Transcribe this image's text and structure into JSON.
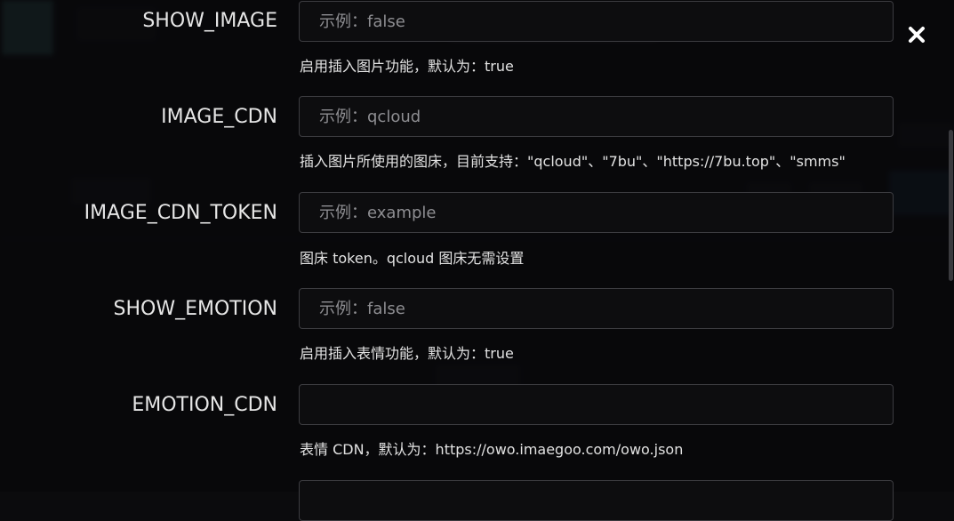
{
  "fields": [
    {
      "label": "SHOW_IMAGE",
      "placeholder": "示例：false",
      "value": "",
      "help": "启用插入图片功能，默认为：true"
    },
    {
      "label": "IMAGE_CDN",
      "placeholder": "示例：qcloud",
      "value": "",
      "help": "插入图片所使用的图床，目前支持：\"qcloud\"、\"7bu\"、\"https://7bu.top\"、\"smms\""
    },
    {
      "label": "IMAGE_CDN_TOKEN",
      "placeholder": "示例：example",
      "value": "",
      "help": "图床 token。qcloud 图床无需设置"
    },
    {
      "label": "SHOW_EMOTION",
      "placeholder": "示例：false",
      "value": "",
      "help": "启用插入表情功能，默认为：true"
    },
    {
      "label": "EMOTION_CDN",
      "placeholder": "",
      "value": "",
      "help": "表情 CDN，默认为：https://owo.imaegoo.com/owo.json"
    },
    {
      "label": "",
      "placeholder": "",
      "value": "",
      "help": ""
    }
  ],
  "close_icon": "close-icon",
  "colors": {
    "overlay": "#0b0b0d",
    "text": "#e6e6e6",
    "input_border": "#3c3c40",
    "placeholder": "#8e8e92"
  }
}
